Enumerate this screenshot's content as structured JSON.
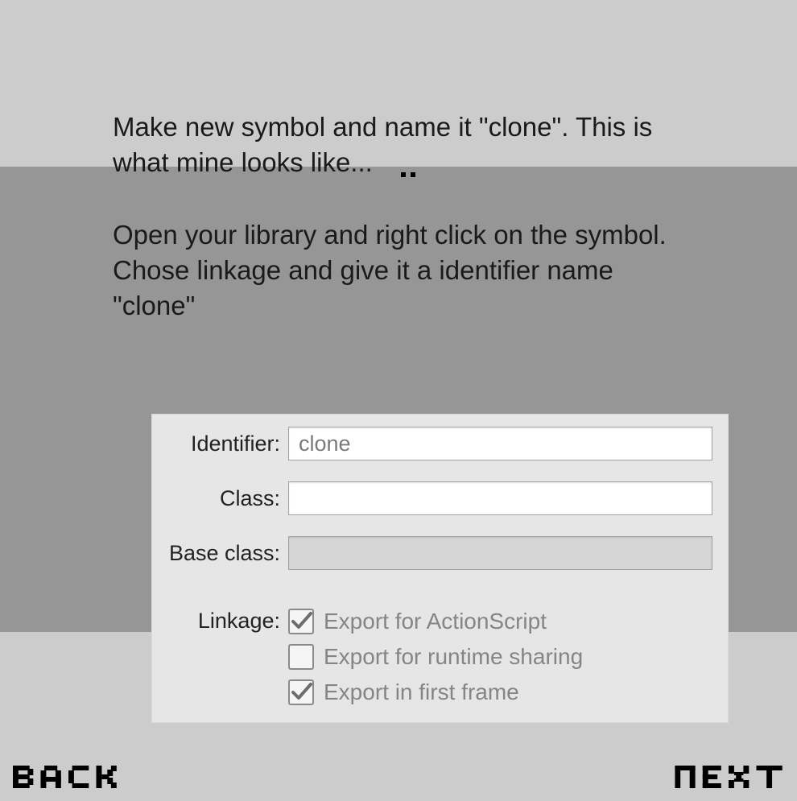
{
  "instructions": {
    "para1a": "Make new symbol and name it \"clone\". This is",
    "para1b": "what mine looks like...",
    "para2": "Open your library and right click on the symbol. Chose linkage and give it a identifier name \"clone\""
  },
  "dialog": {
    "identifier_label": "Identifier:",
    "identifier_value": "clone",
    "class_label": "Class:",
    "class_value": "",
    "base_class_label": "Base class:",
    "base_class_value": "",
    "linkage_label": "Linkage:",
    "opts": {
      "export_as": {
        "label": "Export for ActionScript",
        "checked": true
      },
      "export_runtime": {
        "label": "Export for runtime sharing",
        "checked": false
      },
      "export_first": {
        "label": "Export in first frame",
        "checked": true
      }
    }
  },
  "nav": {
    "back": "BACK",
    "next": "NEXT"
  }
}
